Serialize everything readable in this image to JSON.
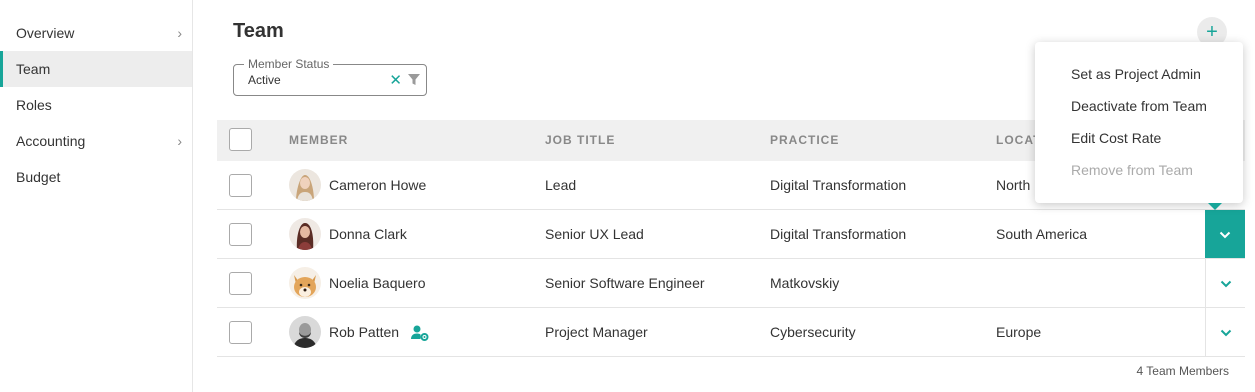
{
  "sidebar": {
    "items": [
      {
        "label": "Overview",
        "has_chevron": true,
        "active": false
      },
      {
        "label": "Team",
        "has_chevron": false,
        "active": true
      },
      {
        "label": "Roles",
        "has_chevron": false,
        "active": false
      },
      {
        "label": "Accounting",
        "has_chevron": true,
        "active": false
      },
      {
        "label": "Budget",
        "has_chevron": false,
        "active": false
      }
    ],
    "chevron_glyph": "›"
  },
  "header": {
    "title": "Team",
    "add_glyph": "+"
  },
  "filter": {
    "label": "Member Status",
    "value": "Active",
    "clear_glyph": "✕"
  },
  "table": {
    "columns": [
      "MEMBER",
      "JOB TITLE",
      "PRACTICE",
      "LOCAT"
    ],
    "rows": [
      {
        "name": "Cameron Howe",
        "job_title": "Lead",
        "practice": "Digital Transformation",
        "location": "North",
        "admin_icon": false
      },
      {
        "name": "Donna Clark",
        "job_title": "Senior UX Lead",
        "practice": "Digital Transformation",
        "location": "South America",
        "admin_icon": false
      },
      {
        "name": "Noelia Baquero",
        "job_title": "Senior Software Engineer",
        "practice": "Matkovskiy",
        "location": "",
        "admin_icon": false
      },
      {
        "name": "Rob Patten",
        "job_title": "Project Manager",
        "practice": "Cybersecurity",
        "location": "Europe",
        "admin_icon": true
      }
    ]
  },
  "footer": {
    "count_text": "4 Team Members"
  },
  "menu": {
    "items": [
      {
        "label": "Set as Project Admin",
        "disabled": false
      },
      {
        "label": "Deactivate from Team",
        "disabled": false
      },
      {
        "label": "Edit Cost Rate",
        "disabled": false
      },
      {
        "label": "Remove from Team",
        "disabled": true
      }
    ]
  },
  "colors": {
    "accent": "#17a599",
    "header_bg": "#f0f0f0",
    "active_bg": "#ededed"
  }
}
